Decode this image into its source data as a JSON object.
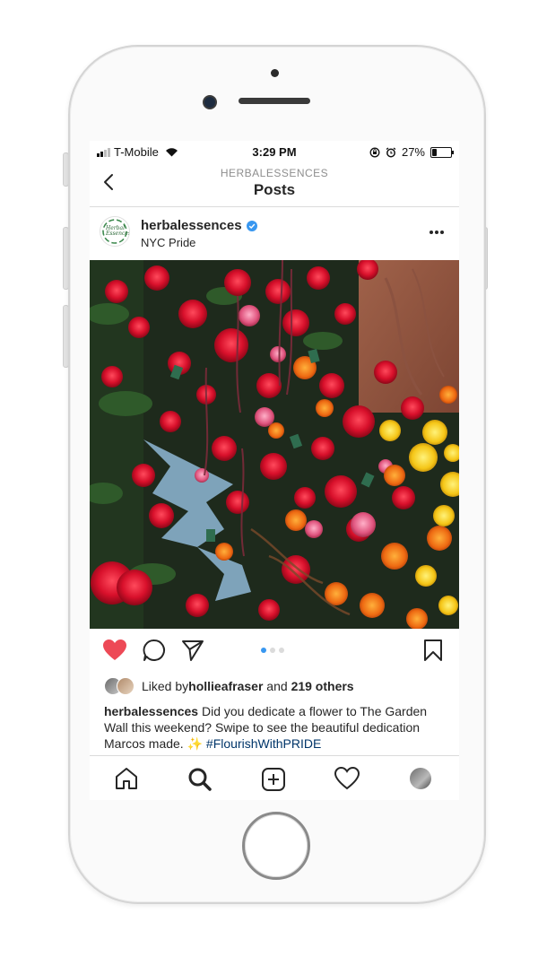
{
  "status_bar": {
    "carrier": "T-Mobile",
    "time": "3:29 PM",
    "battery": "27%",
    "battery_level": 0.27,
    "signal_bars": 2
  },
  "nav": {
    "username": "HERBALESSENCES",
    "title": "Posts"
  },
  "post": {
    "avatar_text": "Herbal Essences",
    "username": "herbalessences",
    "location": "NYC Pride",
    "carousel_total": 3,
    "carousel_active": 1,
    "liked": true,
    "likes_prefix": "Liked by ",
    "liked_by": "hollieafraser",
    "likes_and": " and ",
    "likes_others": "219 others",
    "caption_user": "herbalessences",
    "caption_text": " Did you dedicate a flower to The Garden Wall this weekend? Swipe to see the beautiful dedication Marcos made. ✨ ",
    "caption_hashtag": "#FlourishWithPRIDE"
  },
  "icons": {
    "back": "chevron-left-icon",
    "more": "more-horizontal-icon",
    "like": "heart-icon",
    "comment": "comment-icon",
    "share": "send-icon",
    "save": "bookmark-icon",
    "home": "home-icon",
    "search": "search-icon",
    "new_post": "plus-square-icon",
    "activity": "heart-outline-icon",
    "profile": "profile-avatar"
  },
  "colors": {
    "like_red": "#ed4956",
    "link_blue": "#003569",
    "verified_blue": "#3897f0",
    "text": "#262626"
  }
}
